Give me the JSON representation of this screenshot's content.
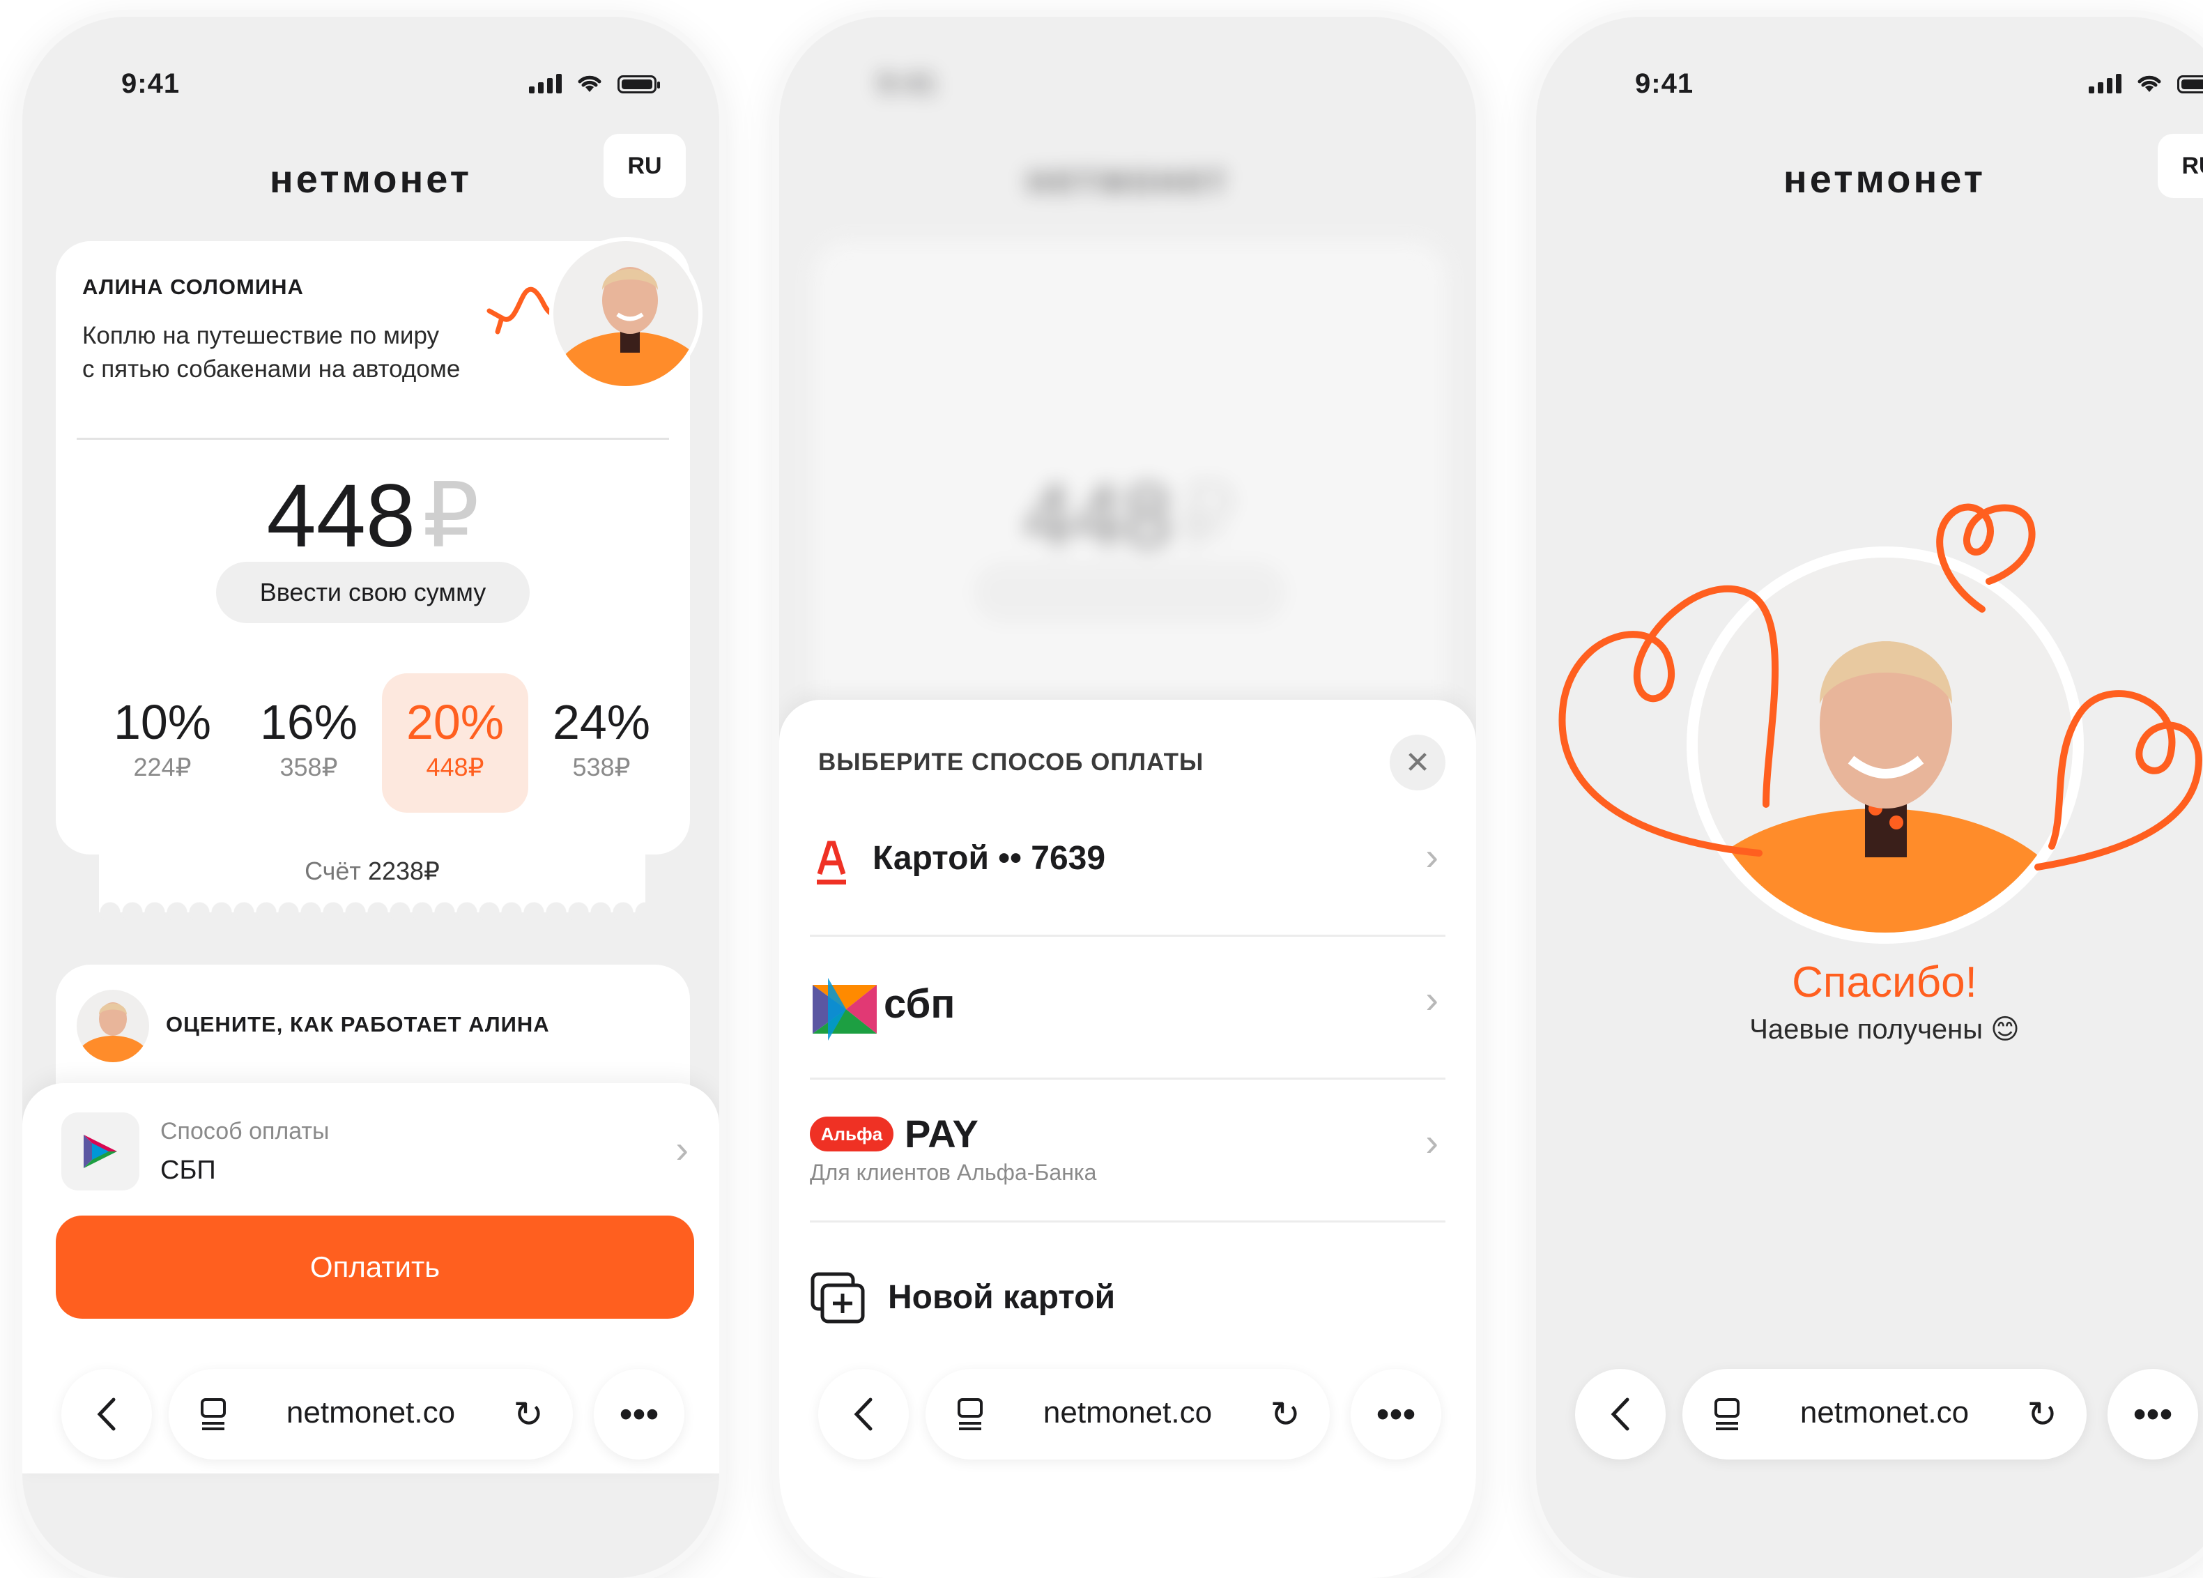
{
  "status": {
    "time": "9:41"
  },
  "brand": {
    "logo": "нетмонет",
    "lang": "RU"
  },
  "profile": {
    "name": "АЛИНА СОЛОМИНА",
    "desc_line1": "Коплю на путешествие по миру",
    "desc_line2": "с пятью собакенами на автодоме"
  },
  "tip": {
    "amount": "448",
    "currency": "₽",
    "custom_label": "Ввести свою сумму",
    "percents": [
      {
        "pct": "10%",
        "sum": "224₽"
      },
      {
        "pct": "16%",
        "sum": "358₽"
      },
      {
        "pct": "20%",
        "sum": "448₽"
      },
      {
        "pct": "24%",
        "sum": "538₽"
      }
    ],
    "selected": 2
  },
  "bill": {
    "label": "Счёт",
    "value": "2238₽"
  },
  "rate": {
    "title": "ОЦЕНИТЕ, КАК РАБОТАЕТ АЛИНА"
  },
  "payment": {
    "label": "Способ оплаты",
    "value": "СБП",
    "button": "Оплатить"
  },
  "browser": {
    "url": "netmonet.co"
  },
  "sheet": {
    "title": "ВЫБЕРИТЕ СПОСОБ ОПЛАТЫ",
    "options": [
      {
        "label": "Картой •• 7639"
      },
      {
        "label": "сбп"
      },
      {
        "badge": "Альфа",
        "label": "PAY",
        "sub": "Для клиентов Альфа-Банка"
      },
      {
        "label": "Новой картой"
      }
    ]
  },
  "success": {
    "title": "Спасибо!",
    "subtitle": "Чаевые получены 😊"
  },
  "colors": {
    "accent": "#ff5f1f",
    "accent_light": "#fde8de",
    "background": "#efefef",
    "alfa_red": "#ef3124"
  },
  "icons": [
    "signal-icon",
    "wifi-icon",
    "battery-icon",
    "chevron-right-icon",
    "close-icon",
    "back-icon",
    "tabs-icon",
    "reload-icon",
    "more-icon",
    "sbp-icon",
    "alfa-icon",
    "new-card-icon",
    "heart-doodle-icon",
    "squiggle-arrow-icon"
  ]
}
